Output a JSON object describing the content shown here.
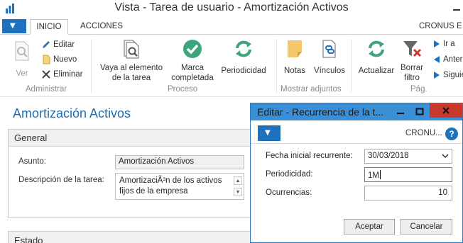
{
  "window": {
    "title": "Vista - Tarea de usuario - Amortización Activos"
  },
  "tabs": {
    "inicio": "INICIO",
    "acciones": "ACCIONES",
    "company": "CRONUS E"
  },
  "ribbon": {
    "ver": "Ver",
    "editar": "Editar",
    "nuevo": "Nuevo",
    "eliminar": "Eliminar",
    "vaya_l1": "Vaya al elemento",
    "vaya_l2": "de la tarea",
    "marca_l1": "Marca",
    "marca_l2": "completada",
    "periodicidad": "Periodicidad",
    "notas": "Notas",
    "vinculos": "Vínculos",
    "actualizar": "Actualizar",
    "borrar_l1": "Borrar",
    "borrar_l2": "filtro",
    "ir_a": "Ir a",
    "anterior": "Anter",
    "siguiente": "Siguie",
    "groups": {
      "administrar": "Administrar",
      "proceso": "Proceso",
      "mostrar_adjuntos": "Mostrar adjuntos",
      "pag": "Pág."
    }
  },
  "page": {
    "title": "Amortización Activos",
    "general_header": "General",
    "asunto_label": "Asunto:",
    "asunto_value": "Amortización Activos",
    "descripcion_label": "Descripción de la tarea:",
    "descripcion_l1": "AmortizaciÃ³n de los activos",
    "descripcion_l2": "fijos de la empresa",
    "estado_header": "Estado"
  },
  "dialog": {
    "title": "Editar - Recurrencia de la t...",
    "company": "CRONU...",
    "help": "?",
    "fecha_label": "Fecha inicial recurrente:",
    "fecha_value": "30/03/2018",
    "periodicidad_label": "Periodicidad:",
    "periodicidad_value": "1M",
    "ocurrencias_label": "Ocurrencias:",
    "ocurrencias_value": "10",
    "aceptar": "Aceptar",
    "cancelar": "Cancelar"
  },
  "colors": {
    "accent_blue": "#1e72bd",
    "title_blue": "#1f6fb5",
    "dialog_title_bg": "#3b8fd7",
    "close_red": "#c7392b",
    "green_icon": "#3ea57b"
  }
}
